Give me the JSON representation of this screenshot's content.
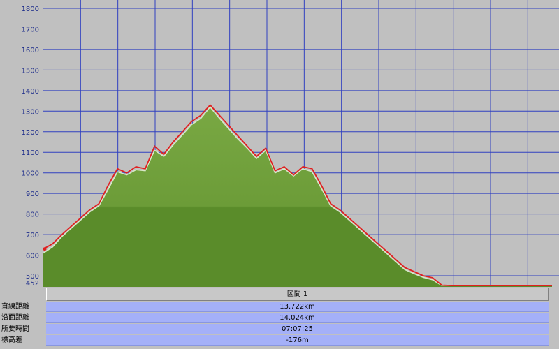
{
  "chart_data": {
    "type": "area",
    "title": "",
    "xlabel": "",
    "ylabel": "",
    "ylim": [
      452,
      1800
    ],
    "y_ticks": [
      500,
      600,
      700,
      800,
      900,
      1000,
      1100,
      1200,
      1300,
      1400,
      1500,
      1600,
      1700,
      1800
    ],
    "y_min_label": "452",
    "grid": true,
    "x": [
      0,
      0.25,
      0.5,
      0.75,
      1.0,
      1.25,
      1.5,
      1.75,
      2.0,
      2.25,
      2.5,
      2.75,
      3.0,
      3.25,
      3.5,
      3.75,
      4.0,
      4.25,
      4.5,
      4.75,
      5.0,
      5.25,
      5.5,
      5.75,
      6.0,
      6.25,
      6.5,
      6.75,
      7.0,
      7.25,
      7.5,
      7.75,
      8.0,
      8.25,
      8.5,
      8.75,
      9.0,
      9.25,
      9.5,
      9.75,
      10.0,
      10.25,
      10.5,
      10.75,
      11.0,
      11.25,
      11.5,
      11.75,
      12.0,
      12.25,
      12.5,
      12.75,
      13.0,
      13.25,
      13.5,
      13.722
    ],
    "series": [
      {
        "color": "#e02020",
        "values": [
          630,
          655,
          700,
          740,
          780,
          820,
          850,
          940,
          1020,
          1000,
          1030,
          1020,
          1130,
          1090,
          1150,
          1200,
          1250,
          1280,
          1330,
          1280,
          1230,
          1180,
          1130,
          1080,
          1120,
          1010,
          1030,
          990,
          1030,
          1020,
          940,
          850,
          820,
          780,
          740,
          700,
          660,
          620,
          580,
          540,
          520,
          500,
          490,
          454,
          452,
          452,
          452,
          452,
          452,
          452,
          452,
          452,
          452,
          452,
          452,
          452
        ]
      },
      {
        "color": "#6f9e3a",
        "values": [
          610,
          640,
          690,
          730,
          770,
          810,
          840,
          920,
          1005,
          990,
          1015,
          1010,
          1110,
          1080,
          1135,
          1185,
          1235,
          1265,
          1320,
          1265,
          1215,
          1165,
          1120,
          1070,
          1110,
          1000,
          1020,
          985,
          1020,
          1005,
          925,
          840,
          810,
          770,
          730,
          690,
          650,
          610,
          570,
          530,
          510,
          492,
          480,
          452,
          452,
          452,
          452,
          452,
          452,
          452,
          452,
          452,
          452,
          452,
          452,
          452
        ]
      }
    ]
  },
  "summary": {
    "section_label": "区間 1",
    "rows": [
      {
        "label": "直線距離",
        "value": "13.722km"
      },
      {
        "label": "沿面距離",
        "value": "14.024km"
      },
      {
        "label": "所要時間",
        "value": "07:07:25"
      },
      {
        "label": "標高差",
        "value": "-176m"
      }
    ]
  }
}
